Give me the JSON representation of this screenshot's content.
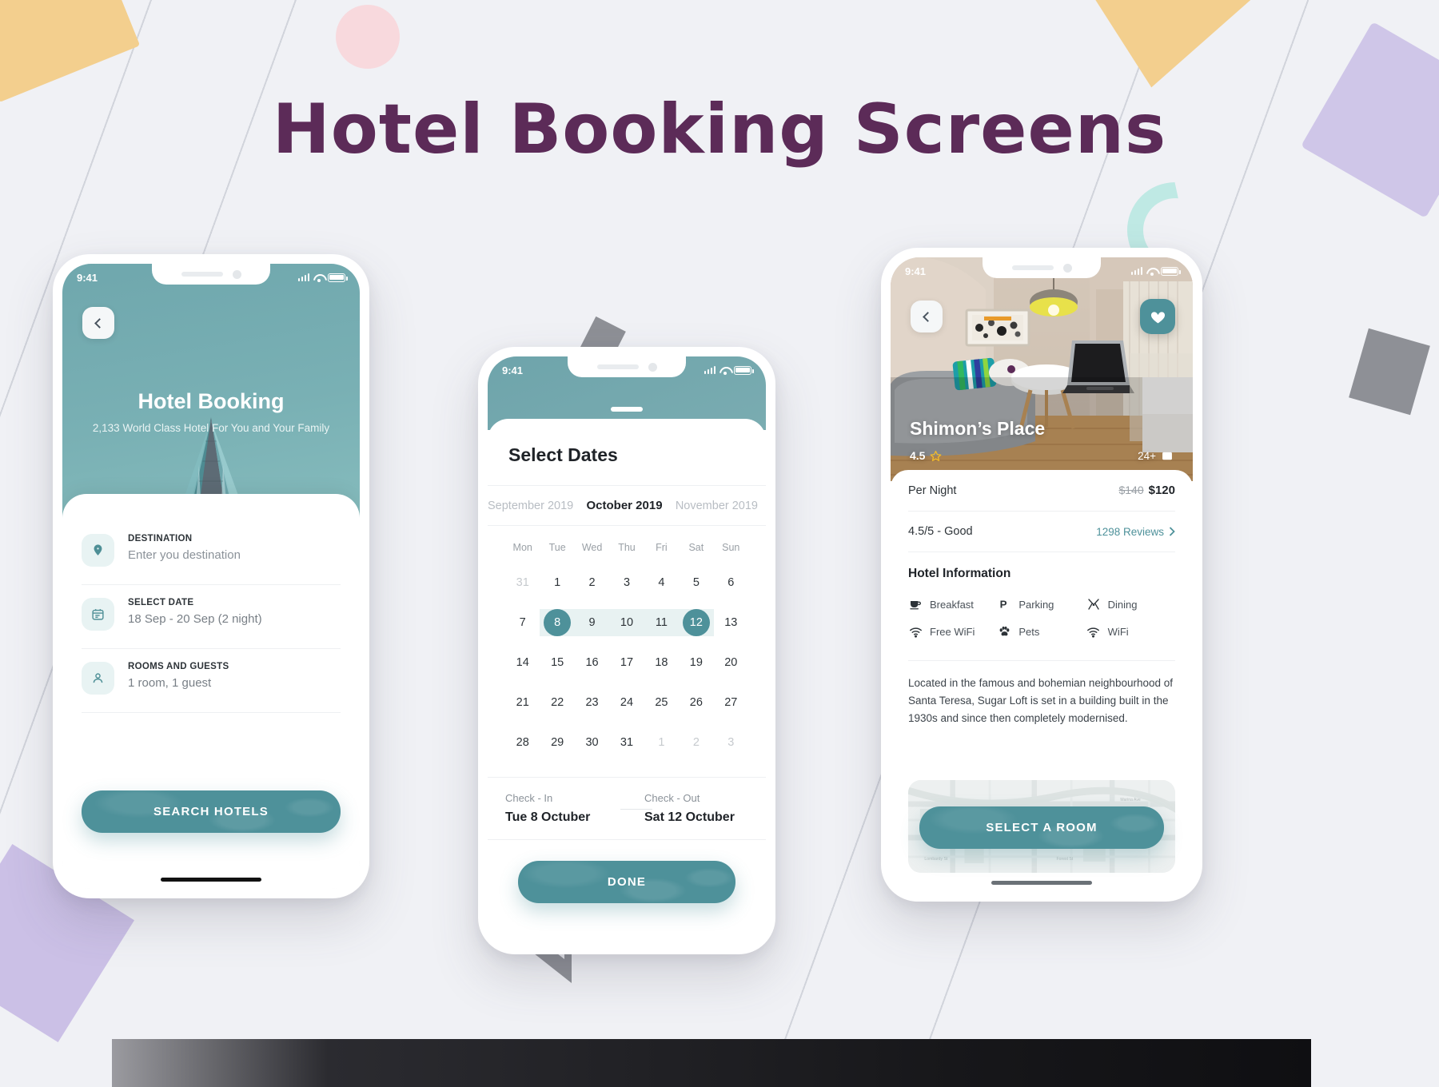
{
  "page": {
    "title": "Hotel Booking Screens",
    "title_color": "#5c2b58",
    "accent": "#4e919a"
  },
  "phone1": {
    "status": {
      "time": "9:41"
    },
    "back_icon": "chevron-left-icon",
    "hero": {
      "title": "Hotel Booking",
      "subtitle": "2,133 World Class Hotel For You and Your Family"
    },
    "fields": [
      {
        "icon": "location-pin-icon",
        "label": "DESTINATION",
        "value": "Enter you destination",
        "is_placeholder": true
      },
      {
        "icon": "calendar-icon",
        "label": "SELECT DATE",
        "value": "18 Sep - 20 Sep (2 night)",
        "is_placeholder": false
      },
      {
        "icon": "person-icon",
        "label": "ROOMS AND GUESTS",
        "value": "1 room, 1 guest",
        "is_placeholder": false
      }
    ],
    "search_button": "SEARCH HOTELS"
  },
  "phone2": {
    "status": {
      "time": "9:41"
    },
    "sheet_title": "Select Dates",
    "months": {
      "prev": "September 2019",
      "current": "October 2019",
      "next": "November 2019"
    },
    "weekdays": [
      "Mon",
      "Tue",
      "Wed",
      "Thu",
      "Fri",
      "Sat",
      "Sun"
    ],
    "weeks": [
      [
        {
          "d": "31",
          "muted": true
        },
        {
          "d": "1"
        },
        {
          "d": "2"
        },
        {
          "d": "3"
        },
        {
          "d": "4"
        },
        {
          "d": "5"
        },
        {
          "d": "6"
        }
      ],
      [
        {
          "d": "7"
        },
        {
          "d": "8",
          "selected": true
        },
        {
          "d": "9",
          "inrange": true
        },
        {
          "d": "10",
          "inrange": true
        },
        {
          "d": "11",
          "inrange": true
        },
        {
          "d": "12",
          "selected": true
        },
        {
          "d": "13"
        }
      ],
      [
        {
          "d": "14"
        },
        {
          "d": "15"
        },
        {
          "d": "16"
        },
        {
          "d": "17"
        },
        {
          "d": "18"
        },
        {
          "d": "19"
        },
        {
          "d": "20"
        }
      ],
      [
        {
          "d": "21"
        },
        {
          "d": "22"
        },
        {
          "d": "23"
        },
        {
          "d": "24"
        },
        {
          "d": "25"
        },
        {
          "d": "26"
        },
        {
          "d": "27"
        }
      ],
      [
        {
          "d": "28"
        },
        {
          "d": "29"
        },
        {
          "d": "30"
        },
        {
          "d": "31"
        },
        {
          "d": "1",
          "muted": true
        },
        {
          "d": "2",
          "muted": true
        },
        {
          "d": "3",
          "muted": true
        }
      ]
    ],
    "check_in": {
      "label": "Check - In",
      "value": "Tue 8 Octuber"
    },
    "check_out": {
      "label": "Check - Out",
      "value": "Sat 12 Octuber"
    },
    "done_button": "DONE"
  },
  "phone3": {
    "status": {
      "time": "9:41"
    },
    "back_icon": "chevron-left-icon",
    "favorite_icon": "heart-icon",
    "hotel_name": "Shimon’s Place",
    "rating": "4.5",
    "rating_star_icon": "star-icon",
    "photo_count": "24+",
    "photo_icon": "image-icon",
    "price_row": {
      "label": "Per Night",
      "old_price": "$140",
      "new_price": "$120"
    },
    "review_row": {
      "label": "4.5/5 - Good",
      "link": "1298 Reviews",
      "chevron": "chevron-right-icon"
    },
    "info_title": "Hotel Information",
    "amenities": [
      {
        "icon": "coffee-cup-icon",
        "label": "Breakfast"
      },
      {
        "icon": "parking-icon",
        "label": "Parking"
      },
      {
        "icon": "dining-icon",
        "label": "Dining"
      },
      {
        "icon": "wifi-icon",
        "label": "Free WiFi"
      },
      {
        "icon": "pets-icon",
        "label": "Pets"
      },
      {
        "icon": "wifi-icon",
        "label": "WiFi"
      }
    ],
    "description": "Located in the famous and bohemian neighbourhood of Santa Teresa, Sugar Loft is set in a building built in the 1930s and since then completely modernised.",
    "select_button": "SELECT A ROOM"
  }
}
